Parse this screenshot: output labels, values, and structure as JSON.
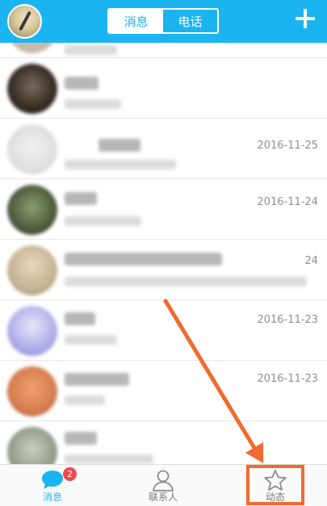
{
  "header": {
    "tabs": [
      {
        "label": "消息",
        "active": true
      },
      {
        "label": "电话",
        "active": false
      }
    ]
  },
  "conversations": [
    {
      "date": ""
    },
    {
      "date": ""
    },
    {
      "date": "2016-11-25"
    },
    {
      "date": "2016-11-24"
    },
    {
      "date": "24"
    },
    {
      "date": "2016-11-23"
    },
    {
      "date": "2016-11-23"
    },
    {
      "date": ""
    }
  ],
  "tabbar": {
    "messages": {
      "label": "消息",
      "badge": "2"
    },
    "contacts": {
      "label": "联系人"
    },
    "moments": {
      "label": "动态"
    }
  },
  "colors": {
    "accent": "#1ab4f1",
    "annotation": "#f26a2f",
    "badge": "#f44848"
  }
}
